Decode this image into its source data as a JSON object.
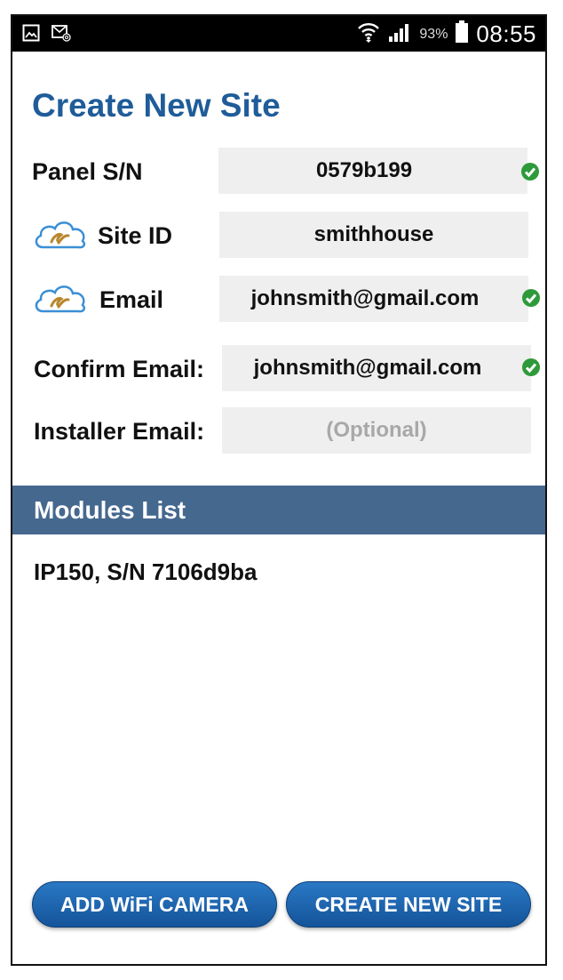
{
  "status_bar": {
    "battery_percent": "93%",
    "time": "08:55",
    "icons": [
      "gallery-icon",
      "mail-icon",
      "wifi-icon",
      "signal-icon",
      "battery-icon"
    ]
  },
  "page": {
    "title": "Create New Site"
  },
  "form": {
    "panel_sn": {
      "label": "Panel S/N",
      "value": "0579b199",
      "valid": true
    },
    "site_id": {
      "label": "Site ID",
      "value": "smithhouse",
      "valid": false
    },
    "email": {
      "label": "Email",
      "value": "johnsmith@gmail.com",
      "valid": true
    },
    "confirm_email": {
      "label": "Confirm Email:",
      "value": "johnsmith@gmail.com",
      "valid": true
    },
    "installer_email": {
      "label": "Installer Email:",
      "value": "",
      "placeholder": "(Optional)"
    }
  },
  "modules": {
    "header": "Modules List",
    "items": [
      "IP150, S/N 7106d9ba"
    ]
  },
  "buttons": {
    "add_camera": "ADD WiFi CAMERA",
    "create_site": "CREATE NEW SITE"
  },
  "colors": {
    "title": "#1f5c99",
    "header_bar": "#45688f",
    "button": "#1a62ad",
    "check": "#2e9a3a",
    "field_bg": "#efefef"
  }
}
